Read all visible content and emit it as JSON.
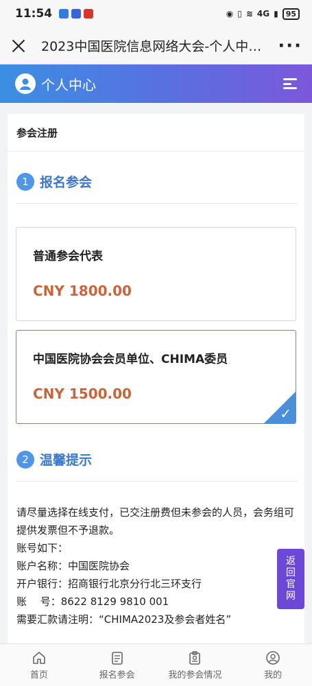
{
  "status_bar": {
    "time": "11:54",
    "battery": "95",
    "signal": "4G"
  },
  "navbar": {
    "title": "2023中国医院信息网络大会-个人中心..."
  },
  "header": {
    "title": "个人中心"
  },
  "card": {
    "title": "参会注册"
  },
  "section1": {
    "number": "1",
    "title": "报名参会"
  },
  "options": [
    {
      "name": "普通参会代表",
      "price": "CNY 1800.00",
      "selected": false
    },
    {
      "name": "中国医院协会会员单位、CHIMA委员",
      "price": "CNY 1500.00",
      "selected": true
    }
  ],
  "section2": {
    "number": "2",
    "title": "温馨提示"
  },
  "notice": {
    "line1": "请尽量选择在线支付，已交注册费但未参会的人员，会务组可提供发票但不予退款。",
    "line2": "账号如下：",
    "line3": "账户名称：中国医院协会",
    "line4": "开户银行：招商银行北京分行北三环支行",
    "line5": "账　 号：8622 8129 9810 001",
    "line6": "需要汇款请注明：“CHIMA2023及参会者姓名”"
  },
  "float_button": {
    "label": "返回官网"
  },
  "tabbar": [
    {
      "label": "首页",
      "icon": "home-icon"
    },
    {
      "label": "报名参会",
      "icon": "form-icon"
    },
    {
      "label": "我的参会情况",
      "icon": "badge-icon"
    },
    {
      "label": "我的",
      "icon": "user-icon"
    }
  ]
}
